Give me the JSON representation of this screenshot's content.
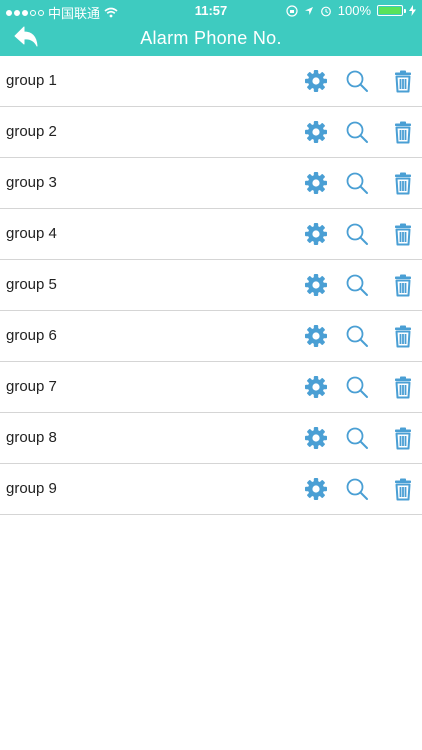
{
  "status_bar": {
    "carrier": "中国联通",
    "time": "11:57",
    "battery_percent": "100%",
    "battery_level": 1.0
  },
  "navbar": {
    "title": "Alarm Phone No.",
    "back_icon": "back-arrow-icon"
  },
  "groups": [
    {
      "label": "group 1"
    },
    {
      "label": "group 2"
    },
    {
      "label": "group 3"
    },
    {
      "label": "group 4"
    },
    {
      "label": "group 5"
    },
    {
      "label": "group 6"
    },
    {
      "label": "group 7"
    },
    {
      "label": "group 8"
    },
    {
      "label": "group 9"
    }
  ],
  "row_icons": [
    "gear-icon",
    "search-icon",
    "trash-icon"
  ],
  "colors": {
    "header": "#3ecbc0",
    "icon": "#4a9fd4",
    "divider": "#d5d5d5"
  }
}
